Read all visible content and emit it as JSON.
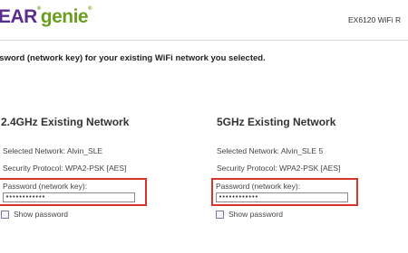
{
  "header": {
    "logo_brand": "EAR",
    "logo_product": "genie",
    "model": "EX6120 WiFi R"
  },
  "instruction": "ssword (network key) for your existing WiFi network you selected.",
  "networks": [
    {
      "title": "2.4GHz Existing Network",
      "selected_network": "Selected Network: Alvin_SLE",
      "security_protocol": "Security Protocol: WPA2-PSK [AES]",
      "password_label": "Password (network key):",
      "password_value": "••••••••••••",
      "show_password_label": "Show password"
    },
    {
      "title": "5GHz Existing Network",
      "selected_network": "Selected Network: Alvin_SLE 5",
      "security_protocol": "Security Protocol: WPA2-PSK [AES]",
      "password_label": "Password (network key):",
      "password_value": "••••••••••••",
      "show_password_label": "Show password"
    }
  ],
  "colors": {
    "brand_purple": "#5c2d91",
    "brand_green": "#6a9e1f",
    "highlight_red": "#d9342b"
  }
}
